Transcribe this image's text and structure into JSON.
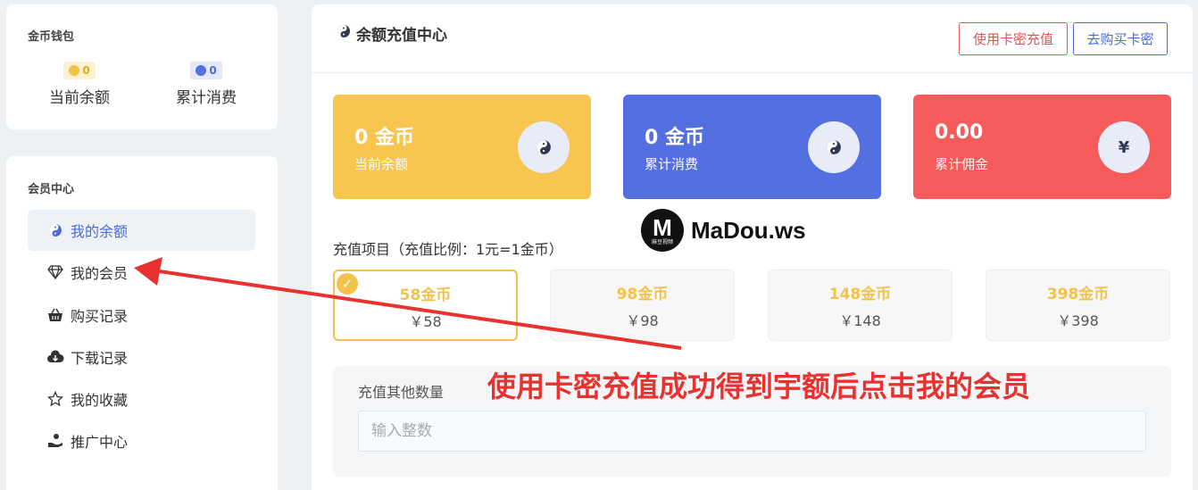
{
  "wallet": {
    "title": "金币钱包",
    "balance": {
      "badge": "0",
      "label": "当前余额"
    },
    "spent": {
      "badge": "0",
      "label": "累计消费"
    }
  },
  "member_center": {
    "title": "会员中心",
    "items": [
      {
        "label": "我的余额",
        "icon": "balance-icon",
        "active": true
      },
      {
        "label": "我的会员",
        "icon": "diamond-icon",
        "active": false
      },
      {
        "label": "购买记录",
        "icon": "basket-icon",
        "active": false
      },
      {
        "label": "下载记录",
        "icon": "cloud-download-icon",
        "active": false
      },
      {
        "label": "我的收藏",
        "icon": "star-icon",
        "active": false
      },
      {
        "label": "推广中心",
        "icon": "hand-coin-icon",
        "active": false
      }
    ]
  },
  "main": {
    "title": "余额充值中心",
    "btn_card": "使用卡密充值",
    "btn_buy": "去购买卡密",
    "stats": [
      {
        "value": "0 金币",
        "label": "当前余额",
        "icon": "yin-yang-icon",
        "color": "#f7c550"
      },
      {
        "value": "0 金币",
        "label": "累计消费",
        "icon": "yin-yang-icon",
        "color": "#5470e0"
      },
      {
        "value": "0.00",
        "label": "累计佣金",
        "icon": "yen-icon",
        "symbol": "¥",
        "color": "#f55b5b"
      }
    ],
    "recharge_label": "充值项目（充值比例：1元=1金币）",
    "options": [
      {
        "coins": "58金币",
        "price": "￥58",
        "selected": true
      },
      {
        "coins": "98金币",
        "price": "￥98",
        "selected": false
      },
      {
        "coins": "148金币",
        "price": "￥148",
        "selected": false
      },
      {
        "coins": "398金币",
        "price": "￥398",
        "selected": false
      }
    ],
    "other_label": "充值其他数量",
    "other_placeholder": "输入整数"
  },
  "overlay": {
    "watermark_logo": "M",
    "watermark_logo_sub": "麻豆视频",
    "watermark_text": "MaDou.ws",
    "annotation": "使用卡密充值成功得到宇额后点击我的会员",
    "annotation_color": "#e8322f"
  },
  "colors": {
    "accent": "#4b6cd4",
    "gold": "#f3c24a",
    "danger": "#e25454"
  }
}
